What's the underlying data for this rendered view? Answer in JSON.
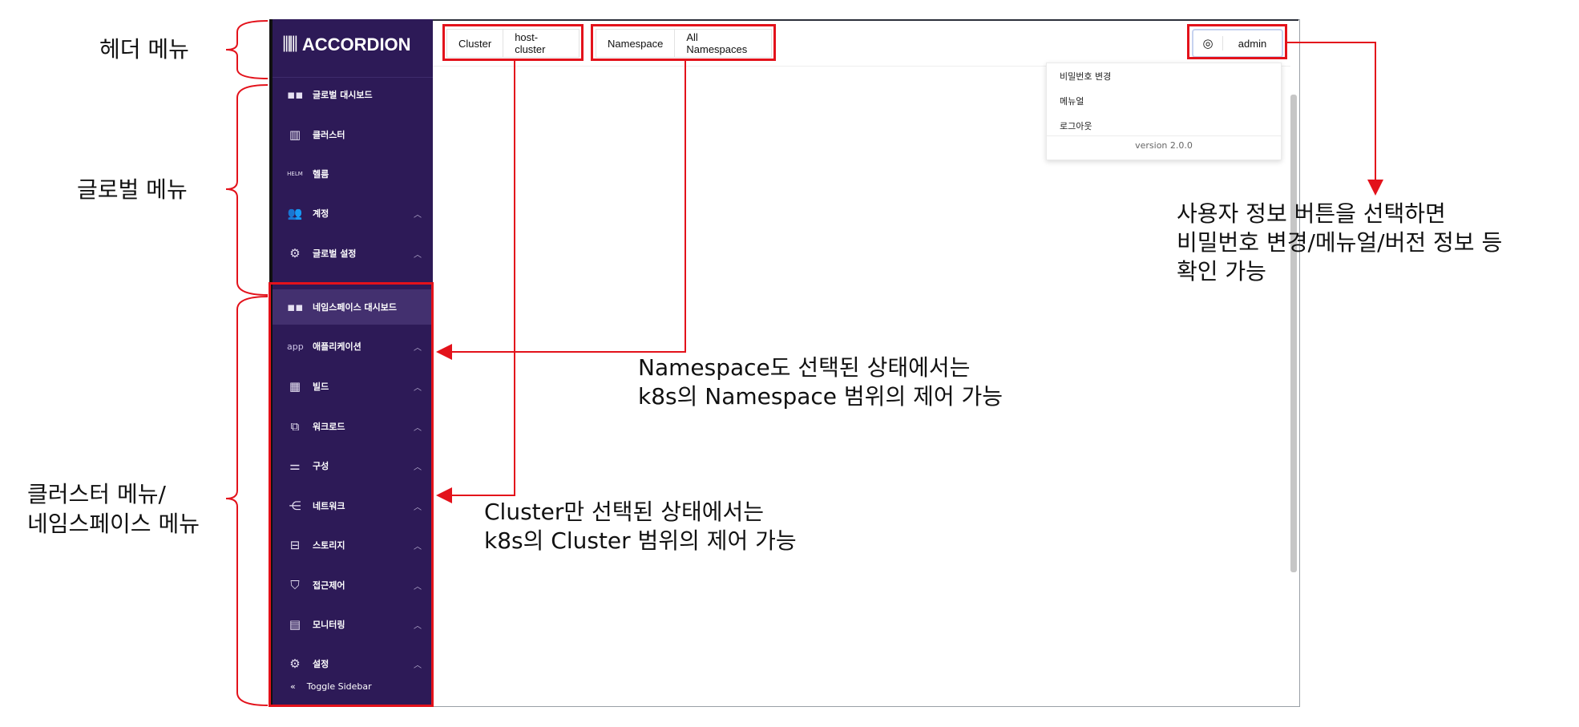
{
  "app": {
    "logo_text": "ACCORDION",
    "header": {
      "cluster_label": "Cluster",
      "cluster_value": "host-cluster",
      "namespace_label": "Namespace",
      "namespace_value": "All Namespaces",
      "user_name": "admin"
    },
    "user_menu": {
      "items": [
        "비밀번호 변경",
        "메뉴얼",
        "로그아웃"
      ],
      "version": "version 2.0.0"
    },
    "sidebar": {
      "global_items": [
        {
          "label": "글로벌 대시보드",
          "icon": "grid-icon",
          "expandable": false
        },
        {
          "label": "클러스터",
          "icon": "columns-icon",
          "expandable": false
        },
        {
          "label": "헬름",
          "icon": "helm-icon",
          "expandable": false
        },
        {
          "label": "계정",
          "icon": "users-icon",
          "expandable": true
        },
        {
          "label": "글로벌 설정",
          "icon": "gear-icon",
          "expandable": true
        }
      ],
      "cluster_items": [
        {
          "label": "네임스페이스 대시보드",
          "icon": "grid-icon",
          "expandable": false,
          "active": true
        },
        {
          "label": "애플리케이션",
          "icon": "app-icon",
          "expandable": true
        },
        {
          "label": "빌드",
          "icon": "build-icon",
          "expandable": true
        },
        {
          "label": "워크로드",
          "icon": "workload-icon",
          "expandable": true
        },
        {
          "label": "구성",
          "icon": "sliders-icon",
          "expandable": true
        },
        {
          "label": "네트워크",
          "icon": "network-icon",
          "expandable": true
        },
        {
          "label": "스토리지",
          "icon": "storage-icon",
          "expandable": true
        },
        {
          "label": "접근제어",
          "icon": "shield-icon",
          "expandable": true
        },
        {
          "label": "모니터링",
          "icon": "chart-icon",
          "expandable": true
        },
        {
          "label": "설정",
          "icon": "gear-icon",
          "expandable": true
        }
      ],
      "app_icon_text": "app",
      "helm_icon_text": "HELM",
      "toggle_icon": "«",
      "toggle_label": "Toggle Sidebar"
    }
  },
  "annotations": {
    "header_menu": "헤더 메뉴",
    "global_menu": "글로벌 메뉴",
    "cluster_menu_line1": "클러스터 메뉴/",
    "cluster_menu_line2": "네임스페이스 메뉴",
    "namespace_note_line1": "Namespace도 선택된 상태에서는",
    "namespace_note_line2": "k8s의 Namespace 범위의 제어 가능",
    "cluster_note_line1": "Cluster만 선택된 상태에서는",
    "cluster_note_line2": "k8s의 Cluster 범위의 제어 가능",
    "user_note_line1": "사용자 정보 버튼을 선택하면",
    "user_note_line2": "비밀번호 변경/메뉴얼/버전 정보 등",
    "user_note_line3": "확인 가능"
  },
  "colors": {
    "sidebar_bg": "#2d1a57",
    "sidebar_active": "#43306f",
    "annotation_red": "#e3121b"
  }
}
